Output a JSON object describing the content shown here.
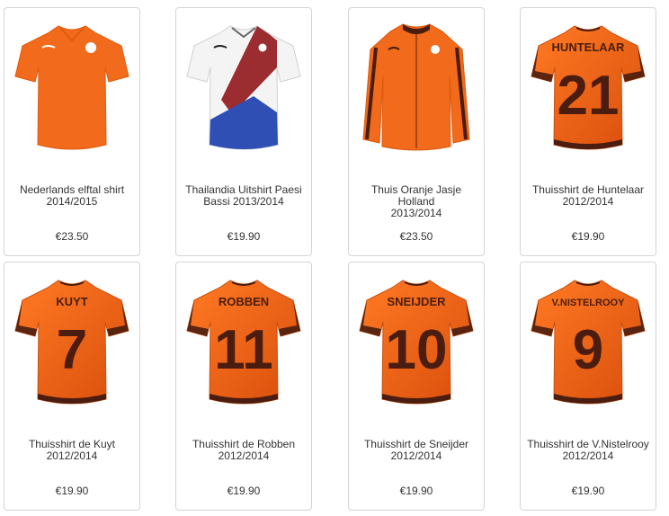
{
  "products": [
    {
      "name_line1": "Nederlands elftal shirt",
      "name_line2": "2014/2015",
      "price": "€23.50",
      "kind": "plain-home",
      "icon": "orange-jersey-icon"
    },
    {
      "name_line1": "Thailandia Uitshirt Paesi",
      "name_line2": "Bassi 2013/2014",
      "price": "€19.90",
      "kind": "away",
      "icon": "white-red-blue-jersey-icon"
    },
    {
      "name_line1": "Thuis Oranje Jasje Holland",
      "name_line2": "2013/2014",
      "price": "€23.50",
      "kind": "jacket",
      "icon": "orange-jacket-icon"
    },
    {
      "name_line1": "Thuisshirt de Huntelaar",
      "name_line2": "2012/2014",
      "price": "€19.90",
      "kind": "back",
      "player": "HUNTELAAR",
      "number": "21",
      "icon": "orange-jersey-back-icon"
    },
    {
      "name_line1": "Thuisshirt de Kuyt",
      "name_line2": "2012/2014",
      "price": "€19.90",
      "kind": "back",
      "player": "KUYT",
      "number": "7",
      "icon": "orange-jersey-back-icon"
    },
    {
      "name_line1": "Thuisshirt de Robben",
      "name_line2": "2012/2014",
      "price": "€19.90",
      "kind": "back",
      "player": "ROBBEN",
      "number": "11",
      "icon": "orange-jersey-back-icon"
    },
    {
      "name_line1": "Thuisshirt de Sneijder",
      "name_line2": "2012/2014",
      "price": "€19.90",
      "kind": "back",
      "player": "SNEIJDER",
      "number": "10",
      "icon": "orange-jersey-back-icon"
    },
    {
      "name_line1": "Thuisshirt de V.Nistelrooy",
      "name_line2": "2012/2014",
      "price": "€19.90",
      "kind": "back",
      "player": "V.NISTELROOY",
      "number": "9",
      "icon": "orange-jersey-back-icon"
    }
  ],
  "colors": {
    "orange": "#f26a1b",
    "dark": "#4a1d10",
    "red": "#9b2c2f",
    "blue": "#2f4fb5",
    "border": "#d4d4d4"
  }
}
